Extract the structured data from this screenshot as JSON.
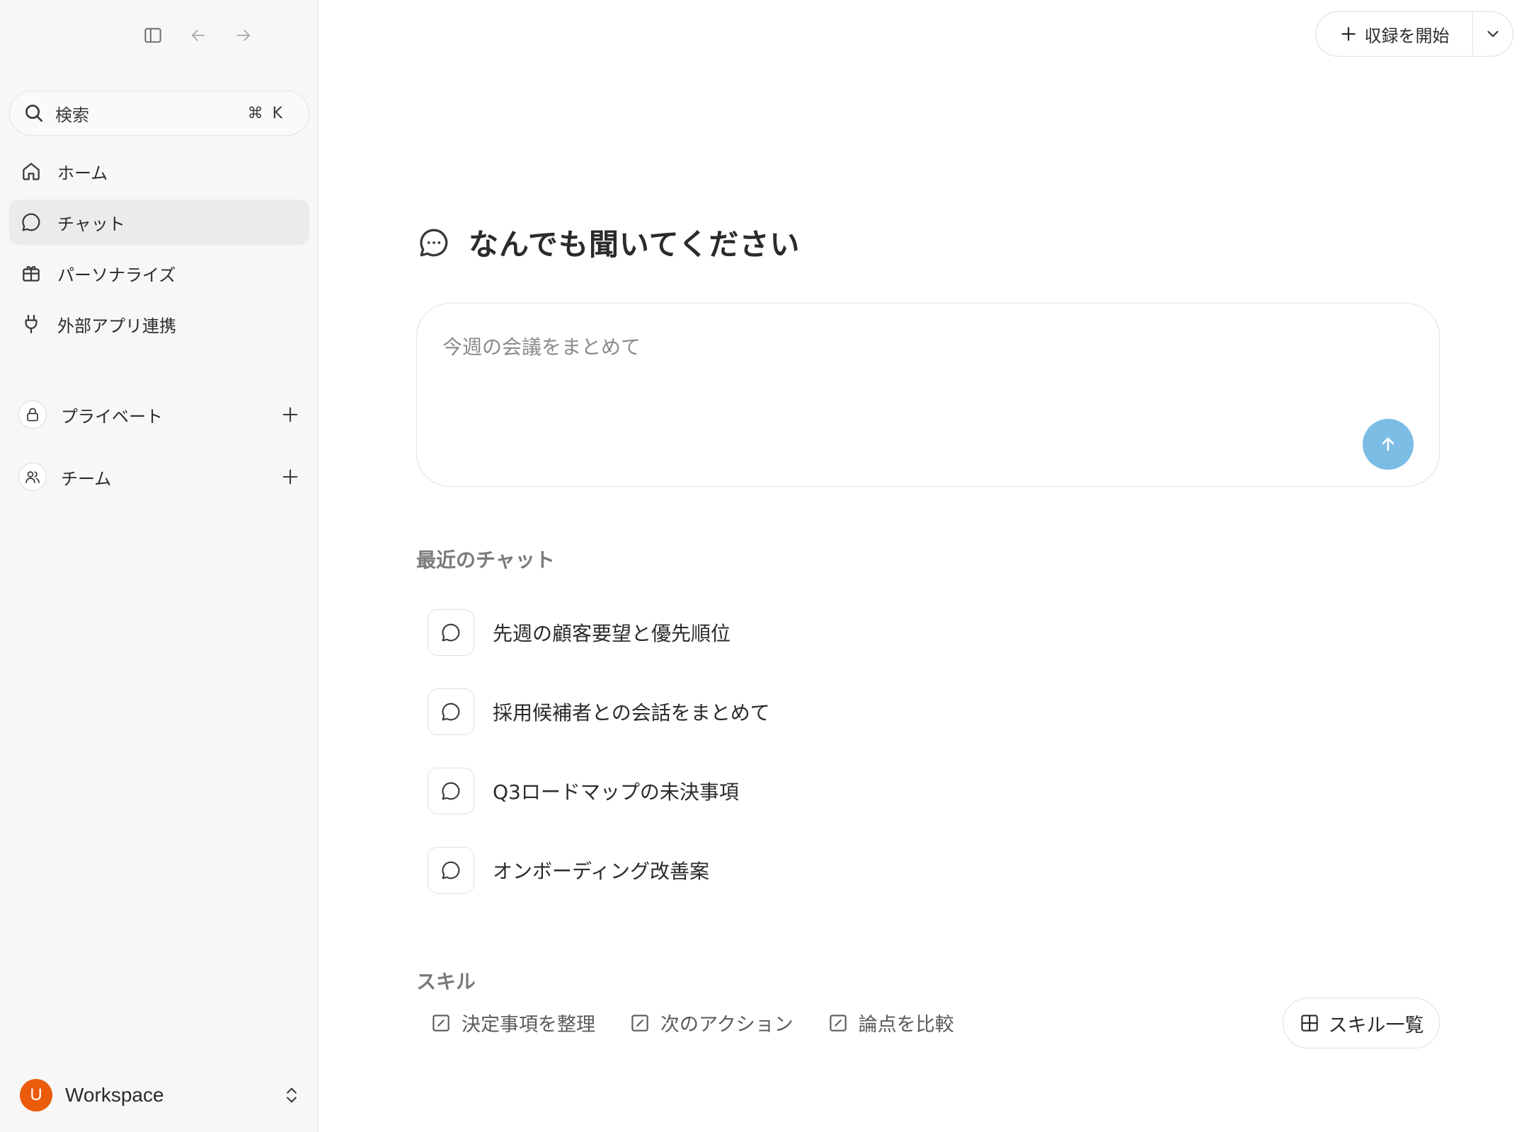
{
  "sidebar": {
    "search": {
      "label": "検索",
      "shortcut": "⌘ K"
    },
    "nav": [
      {
        "label": "ホーム",
        "icon": "home-icon",
        "active": false
      },
      {
        "label": "チャット",
        "icon": "chat-icon",
        "active": true
      },
      {
        "label": "パーソナライズ",
        "icon": "gift-icon",
        "active": false
      },
      {
        "label": "外部アプリ連携",
        "icon": "plug-icon",
        "active": false
      }
    ],
    "sections": {
      "private": {
        "label": "プライベート",
        "icon": "lock-icon"
      },
      "team": {
        "label": "チーム",
        "icon": "users-icon"
      }
    },
    "workspace": {
      "avatar_letter": "U",
      "name": "Workspace",
      "avatar_color": "#ea5b0c"
    }
  },
  "header": {
    "record_label": "収録を開始"
  },
  "main": {
    "heading": "なんでも聞いてください",
    "composer": {
      "placeholder": "今週の会議をまとめて",
      "send_color": "#7cbde6"
    },
    "recent": {
      "title": "最近のチャット",
      "items": [
        "先週の顧客要望と優先順位",
        "採用候補者との会話をまとめて",
        "Q3ロードマップの未決事項",
        "オンボーディング改善案"
      ]
    },
    "skills": {
      "title": "スキル",
      "items": [
        "決定事項を整理",
        "次のアクション",
        "論点を比較"
      ],
      "all_label": "スキル一覧"
    }
  }
}
